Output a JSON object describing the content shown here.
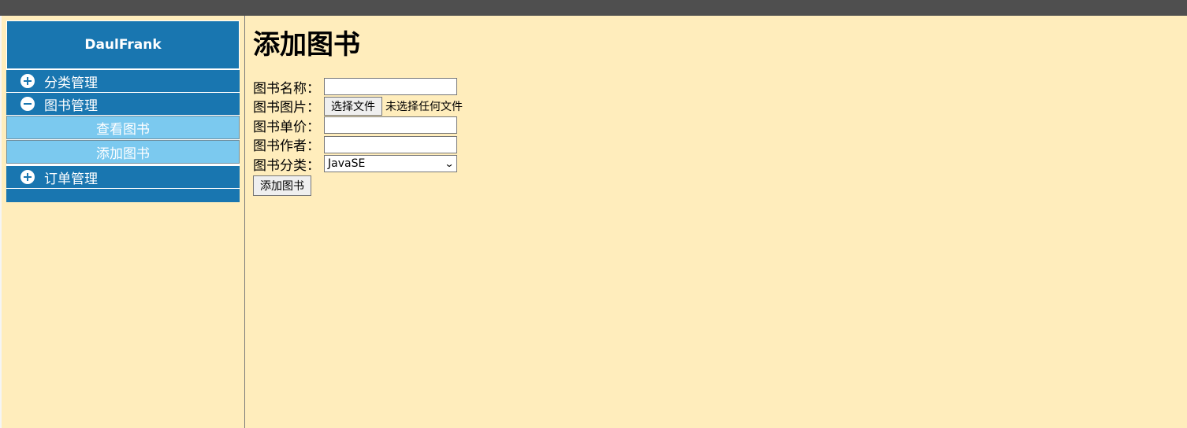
{
  "menu": {
    "brand": "DaulFrank",
    "groups": [
      {
        "label": "分类管理",
        "icon": "plus-circle-icon",
        "expanded": false
      },
      {
        "label": "图书管理",
        "icon": "minus-circle-icon",
        "expanded": true,
        "items": [
          "查看图书",
          "添加图书"
        ]
      },
      {
        "label": "订单管理",
        "icon": "plus-circle-icon",
        "expanded": false
      }
    ]
  },
  "page": {
    "title": "添加图书",
    "form": {
      "name_label": "图书名称：",
      "image_label": "图书图片：",
      "file_button": "选择文件",
      "file_status": "未选择任何文件",
      "price_label": "图书单价：",
      "author_label": "图书作者：",
      "category_label": "图书分类：",
      "category_selected": "JavaSE",
      "submit_label": "添加图书"
    }
  },
  "colors": {
    "topbar": "#4f4f4f",
    "background": "#ffedbc",
    "menu_primary": "#1976b0",
    "menu_sub": "#7bc9ef"
  }
}
